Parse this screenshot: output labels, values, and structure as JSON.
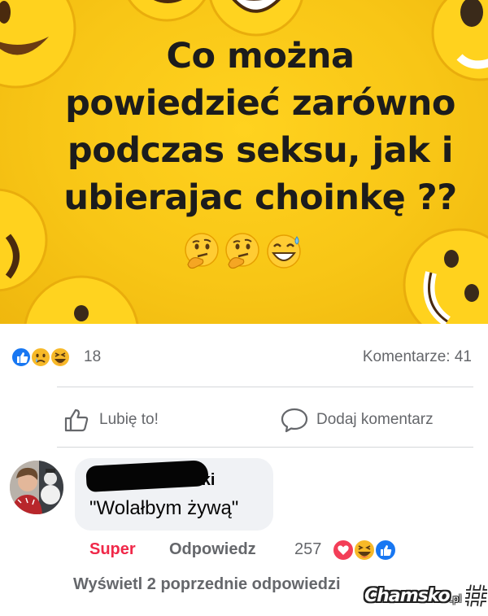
{
  "post": {
    "headline_lines": [
      "Co można",
      "powiedzieć zarówno",
      "podczas  seksu, jak i",
      "ubierajac  choinkę ??"
    ],
    "emoji_icons": [
      "thinking-face-icon",
      "thinking-face-icon",
      "grinning-sweat-icon"
    ],
    "background_color": "#f8c616"
  },
  "reactions": {
    "icons": [
      "like-icon",
      "sad-icon",
      "haha-icon"
    ],
    "count": "18",
    "comments_label": "Komentarze: 41"
  },
  "actions": {
    "like_label": "Lubię to!",
    "comment_label": "Dodaj komentarz"
  },
  "comment": {
    "author_visible": "ski",
    "text": "\"Wolałbym żywą\"",
    "super_label": "Super",
    "reply_label": "Odpowiedz",
    "reaction_count": "257",
    "reaction_icons": [
      "love-icon",
      "haha-icon",
      "like-icon"
    ],
    "view_replies": "Wyświetl 2 poprzednie odpowiedzi"
  },
  "watermark": {
    "text": "Chamsko",
    "tld": ".pl"
  },
  "colors": {
    "like_blue": "#1877f2",
    "love_red": "#f33e58",
    "emoji_yellow": "#f7b928",
    "super_red": "#f02849"
  }
}
